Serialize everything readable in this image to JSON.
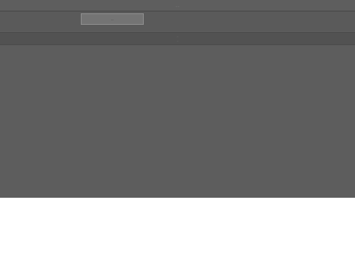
{
  "window": {
    "title": "..."
  },
  "toolbar": {
    "primary_button_label": "..."
  },
  "info": {
    "line_1": "...",
    "line_2": "..."
  }
}
